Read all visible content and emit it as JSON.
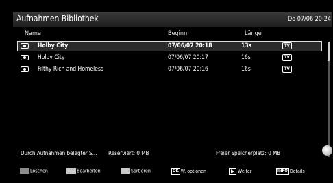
{
  "header": {
    "title": "Aufnahmen-Bibliothek",
    "datetime": "Do 07/06 20:24"
  },
  "columns": {
    "name": "Name",
    "start": "Beginn",
    "length": "Länge"
  },
  "recordings": [
    {
      "name": "Holby City",
      "start": "07/06/07  20:18",
      "length": "13s",
      "badge": "TV",
      "icon": "watched-eye-icon",
      "selected": true
    },
    {
      "name": "Holby City",
      "start": "07/06/07  20:17",
      "length": "16s",
      "badge": "TV",
      "icon": "watched-eye-icon",
      "selected": false
    },
    {
      "name": "Filthy Rich and Homeless",
      "start": "07/06/07  20:16",
      "length": "16s",
      "badge": "TV",
      "icon": "watched-eye-icon",
      "selected": false
    }
  ],
  "status": {
    "used_label": "Durch Aufnahmen belegter S...",
    "reserved": "Reserviert: 0 MB",
    "free": "Freier Speicherplatz: 0 MB"
  },
  "footer": {
    "delete": "Löschen",
    "edit": "Bearbeiten",
    "sort": "Sortieren",
    "ok_key": "OK",
    "options": "W. optionen",
    "next": "Weiter",
    "info_key": "INFO",
    "details": "Details",
    "swatch_colors": [
      "#8b8b8b",
      "#c9c9c9"
    ]
  }
}
